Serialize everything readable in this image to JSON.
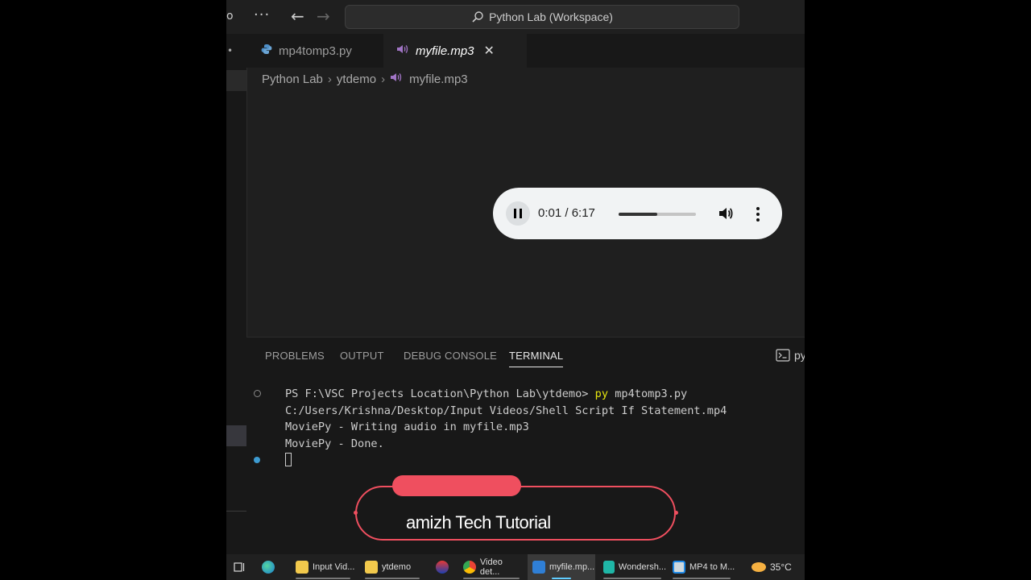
{
  "titlebar": {
    "clip_text": "o",
    "more_glyph": "···",
    "back_glyph": "←",
    "forward_glyph": "→",
    "search_text": "Python Lab (Workspace)"
  },
  "tabs": [
    {
      "label": "mp4tomp3.py",
      "icon": "python-icon",
      "active": false
    },
    {
      "label": "myfile.mp3",
      "icon": "audio-file-icon",
      "active": true,
      "close_glyph": "✕"
    }
  ],
  "breadcrumb": [
    "Python Lab",
    "ytdemo",
    "myfile.mp3"
  ],
  "breadcrumb_sep": "›",
  "player": {
    "state": "playing",
    "time": "0:01 / 6:17",
    "progress": 0.5,
    "icons": [
      "pause-icon",
      "volume-icon",
      "more-options-icon"
    ]
  },
  "panel": {
    "tabs": [
      "PROBLEMS",
      "OUTPUT",
      "DEBUG CONSOLE",
      "TERMINAL"
    ],
    "active_tab": "TERMINAL",
    "shell_label": "py",
    "terminal": {
      "prompt": "PS F:\\VSC Projects Location\\Python Lab\\ytdemo> ",
      "command": "py",
      "args": " mp4tomp3.py",
      "lines": [
        "C:/Users/Krishna/Desktop/Input Videos/Shell Script If Statement.mp4",
        "MoviePy - Writing audio in myfile.mp3",
        "MoviePy - Done."
      ]
    }
  },
  "watermark": {
    "text": "amizh Tech Tutorial"
  },
  "taskbar": {
    "items": [
      {
        "label": "",
        "icon": "task-view-icon"
      },
      {
        "label": "",
        "icon": "edge-icon"
      },
      {
        "label": "Input Vid...",
        "icon": "folder-icon"
      },
      {
        "label": "ytdemo",
        "icon": "folder-icon"
      },
      {
        "label": "",
        "icon": "app-icon"
      },
      {
        "label": "Video det...",
        "icon": "chrome-icon"
      },
      {
        "label": "myfile.mp...",
        "icon": "vscode-icon",
        "active": true
      },
      {
        "label": "Wondersh...",
        "icon": "filmora-icon"
      },
      {
        "label": "MP4 to M...",
        "icon": "app-window-icon"
      }
    ],
    "weather": "35°C"
  },
  "colors": {
    "accent_watermark": "#ef4f5f",
    "terminal_command": "#e5e510",
    "active_taskbar": "#60cdff"
  }
}
